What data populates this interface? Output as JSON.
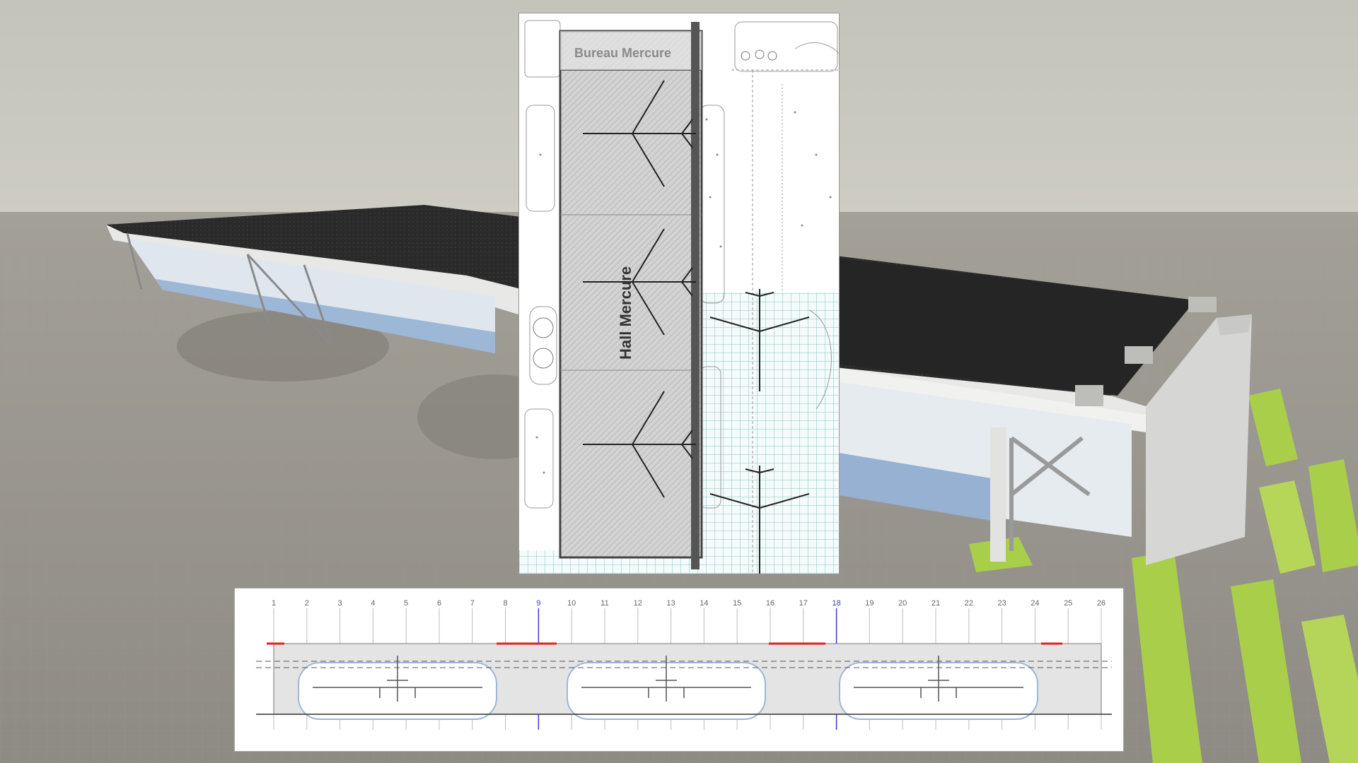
{
  "plan": {
    "office_label": "Bureau Mercure",
    "hall_label": "Hall Mercure"
  },
  "section": {
    "axis_labels": [
      "1",
      "2",
      "3",
      "4",
      "5",
      "6",
      "7",
      "8",
      "9",
      "10",
      "11",
      "12",
      "13",
      "14",
      "15",
      "16",
      "17",
      "18",
      "19",
      "20",
      "21",
      "22",
      "23",
      "24",
      "25",
      "26"
    ],
    "highlighted_axes": [
      "9",
      "18"
    ]
  },
  "colors": {
    "sky": "#c9c9c1",
    "ground": "#a8a59d",
    "apron": "#8f8d86",
    "roof": "#262626",
    "grass": "#a9cf4a",
    "plan_hatch": "#c8c8c8",
    "grid_teal": "#7fc6c1",
    "section_red": "#e02020",
    "section_blue": "#3a3ad0"
  }
}
